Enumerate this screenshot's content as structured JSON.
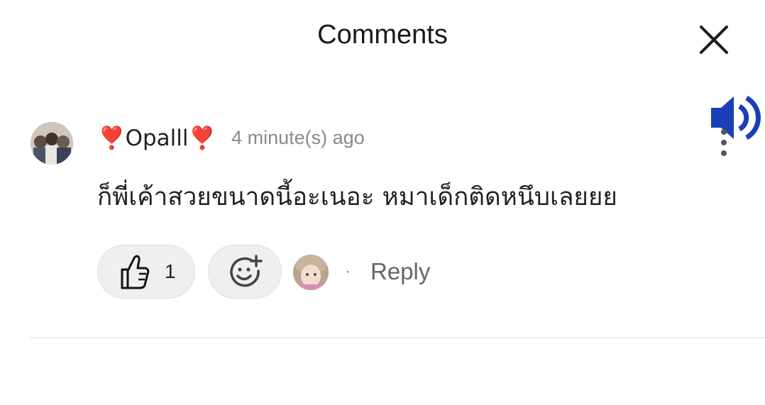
{
  "header": {
    "title": "Comments"
  },
  "comment": {
    "author": "❣️Opalll❣️",
    "time": "4 minute(s) ago",
    "text": "ก็พี่เค้าสวยขนาดนี้อะเนอะ หมาเด็กติดหนึบเลยยย",
    "likes": "1",
    "reply_label": "Reply",
    "separator": "·"
  },
  "icons": {
    "close": "close-icon",
    "speaker": "speaker-icon",
    "more": "more-vertical-icon",
    "like": "thumbs-up-icon",
    "react": "add-reaction-icon"
  },
  "colors": {
    "speaker": "#1a3fb8",
    "pill_bg": "#efefef",
    "muted_text": "#8a8a8a"
  }
}
